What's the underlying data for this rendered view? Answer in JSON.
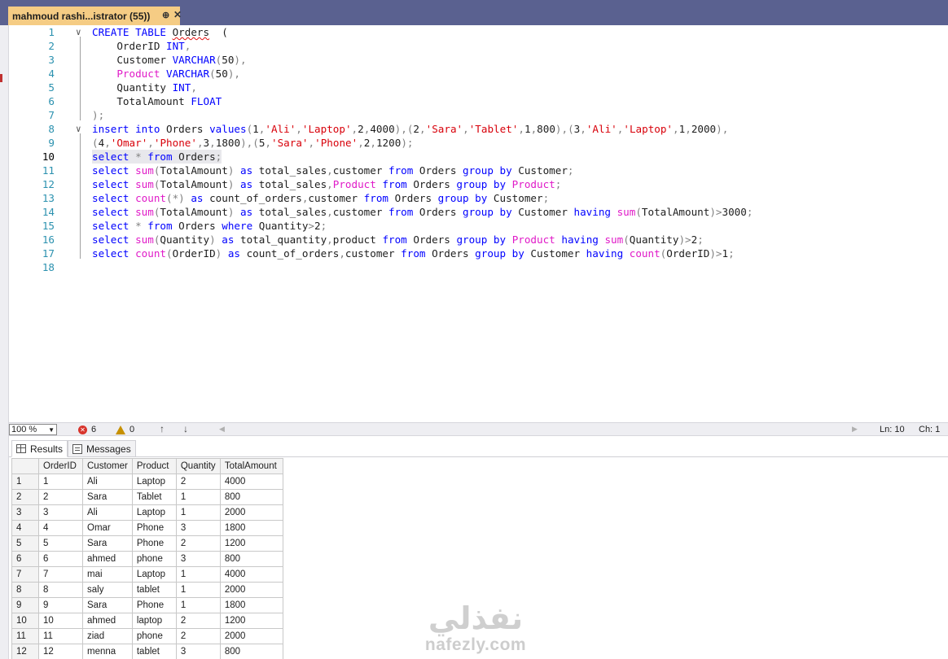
{
  "tab": {
    "title": "mahmoud rashi...istrator (55))",
    "pin": "⊕",
    "close": "✕"
  },
  "colors": {
    "keyword": "#0000ff",
    "string": "#d8000a",
    "function": "#e01ac8",
    "operator": "#808080",
    "line_number": "#2b91af",
    "tab_bg": "#f5cc84",
    "tabstrip_bg": "#5a6190"
  },
  "editor": {
    "current_line": 10,
    "lines": [
      {
        "n": "1"
      },
      {
        "n": "2"
      },
      {
        "n": "3"
      },
      {
        "n": "4"
      },
      {
        "n": "5"
      },
      {
        "n": "6"
      },
      {
        "n": "7"
      },
      {
        "n": "8"
      },
      {
        "n": "9"
      },
      {
        "n": "10"
      },
      {
        "n": "11"
      },
      {
        "n": "12"
      },
      {
        "n": "13"
      },
      {
        "n": "14"
      },
      {
        "n": "15"
      },
      {
        "n": "16"
      },
      {
        "n": "17"
      },
      {
        "n": "18"
      }
    ],
    "code": [
      [
        [
          "kw",
          "CREATE TABLE "
        ],
        [
          "sq",
          "Orders"
        ],
        [
          "",
          "  ("
        ]
      ],
      [
        [
          "",
          "    OrderID "
        ],
        [
          "kw",
          "INT"
        ],
        [
          "gr",
          ","
        ]
      ],
      [
        [
          "",
          "    Customer "
        ],
        [
          "kw",
          "VARCHAR"
        ],
        [
          "gr",
          "("
        ],
        [
          "",
          "50"
        ],
        [
          "gr",
          "),"
        ]
      ],
      [
        [
          "fn",
          "    Product "
        ],
        [
          "kw",
          "VARCHAR"
        ],
        [
          "gr",
          "("
        ],
        [
          "",
          "50"
        ],
        [
          "gr",
          "),"
        ]
      ],
      [
        [
          "",
          "    Quantity "
        ],
        [
          "kw",
          "INT"
        ],
        [
          "gr",
          ","
        ]
      ],
      [
        [
          "",
          "    TotalAmount "
        ],
        [
          "kw",
          "FLOAT"
        ]
      ],
      [
        [
          "gr",
          ");"
        ]
      ],
      [
        [
          "kw",
          "insert into "
        ],
        [
          "",
          "Orders "
        ],
        [
          "kw",
          "values"
        ],
        [
          "gr",
          "("
        ],
        [
          "",
          "1"
        ],
        [
          "gr",
          ","
        ],
        [
          "str",
          "'Ali'"
        ],
        [
          "gr",
          ","
        ],
        [
          "str",
          "'Laptop'"
        ],
        [
          "gr",
          ","
        ],
        [
          "",
          "2"
        ],
        [
          "gr",
          ","
        ],
        [
          "",
          "4000"
        ],
        [
          "gr",
          "),("
        ],
        [
          "",
          "2"
        ],
        [
          "gr",
          ","
        ],
        [
          "str",
          "'Sara'"
        ],
        [
          "gr",
          ","
        ],
        [
          "str",
          "'Tablet'"
        ],
        [
          "gr",
          ","
        ],
        [
          "",
          "1"
        ],
        [
          "gr",
          ","
        ],
        [
          "",
          "800"
        ],
        [
          "gr",
          "),("
        ],
        [
          "",
          "3"
        ],
        [
          "gr",
          ","
        ],
        [
          "str",
          "'Ali'"
        ],
        [
          "gr",
          ","
        ],
        [
          "str",
          "'Laptop'"
        ],
        [
          "gr",
          ","
        ],
        [
          "",
          "1"
        ],
        [
          "gr",
          ","
        ],
        [
          "",
          "2000"
        ],
        [
          "gr",
          "),"
        ]
      ],
      [
        [
          "gr",
          "("
        ],
        [
          "",
          "4"
        ],
        [
          "gr",
          ","
        ],
        [
          "str",
          "'Omar'"
        ],
        [
          "gr",
          ","
        ],
        [
          "str",
          "'Phone'"
        ],
        [
          "gr",
          ","
        ],
        [
          "",
          "3"
        ],
        [
          "gr",
          ","
        ],
        [
          "",
          "1800"
        ],
        [
          "gr",
          "),("
        ],
        [
          "",
          "5"
        ],
        [
          "gr",
          ","
        ],
        [
          "str",
          "'Sara'"
        ],
        [
          "gr",
          ","
        ],
        [
          "str",
          "'Phone'"
        ],
        [
          "gr",
          ","
        ],
        [
          "",
          "2"
        ],
        [
          "gr",
          ","
        ],
        [
          "",
          "1200"
        ],
        [
          "gr",
          ");"
        ]
      ],
      [
        [
          "kw",
          "select "
        ],
        [
          "gr",
          "* "
        ],
        [
          "kw",
          "from "
        ],
        [
          "",
          "Orders"
        ],
        [
          "gr",
          ";"
        ]
      ],
      [
        [
          "kw",
          "select "
        ],
        [
          "fn",
          "sum"
        ],
        [
          "gr",
          "("
        ],
        [
          "",
          "TotalAmount"
        ],
        [
          "gr",
          ") "
        ],
        [
          "kw",
          "as "
        ],
        [
          "",
          "total_sales"
        ],
        [
          "gr",
          ","
        ],
        [
          "",
          "customer "
        ],
        [
          "kw",
          "from "
        ],
        [
          "",
          "Orders "
        ],
        [
          "kw",
          "group by "
        ],
        [
          "",
          "Customer"
        ],
        [
          "gr",
          ";"
        ]
      ],
      [
        [
          "kw",
          "select "
        ],
        [
          "fn",
          "sum"
        ],
        [
          "gr",
          "("
        ],
        [
          "",
          "TotalAmount"
        ],
        [
          "gr",
          ") "
        ],
        [
          "kw",
          "as "
        ],
        [
          "",
          "total_sales"
        ],
        [
          "gr",
          ","
        ],
        [
          "fn",
          "Product "
        ],
        [
          "kw",
          "from "
        ],
        [
          "",
          "Orders "
        ],
        [
          "kw",
          "group by "
        ],
        [
          "fn",
          "Product"
        ],
        [
          "gr",
          ";"
        ]
      ],
      [
        [
          "kw",
          "select "
        ],
        [
          "fn",
          "count"
        ],
        [
          "gr",
          "(*) "
        ],
        [
          "kw",
          "as "
        ],
        [
          "",
          "count_of_orders"
        ],
        [
          "gr",
          ","
        ],
        [
          "",
          "customer "
        ],
        [
          "kw",
          "from "
        ],
        [
          "",
          "Orders "
        ],
        [
          "kw",
          "group by "
        ],
        [
          "",
          "Customer"
        ],
        [
          "gr",
          ";"
        ]
      ],
      [
        [
          "kw",
          "select "
        ],
        [
          "fn",
          "sum"
        ],
        [
          "gr",
          "("
        ],
        [
          "",
          "TotalAmount"
        ],
        [
          "gr",
          ") "
        ],
        [
          "kw",
          "as "
        ],
        [
          "",
          "total_sales"
        ],
        [
          "gr",
          ","
        ],
        [
          "",
          "customer "
        ],
        [
          "kw",
          "from "
        ],
        [
          "",
          "Orders "
        ],
        [
          "kw",
          "group by "
        ],
        [
          "",
          "Customer "
        ],
        [
          "kw",
          "having "
        ],
        [
          "fn",
          "sum"
        ],
        [
          "gr",
          "("
        ],
        [
          "",
          "TotalAmount"
        ],
        [
          "gr",
          ")>"
        ],
        [
          "",
          "3000"
        ],
        [
          "gr",
          ";"
        ]
      ],
      [
        [
          "kw",
          "select "
        ],
        [
          "gr",
          "* "
        ],
        [
          "kw",
          "from "
        ],
        [
          "",
          "Orders "
        ],
        [
          "kw",
          "where "
        ],
        [
          "",
          "Quantity"
        ],
        [
          "gr",
          ">"
        ],
        [
          "",
          "2"
        ],
        [
          "gr",
          ";"
        ]
      ],
      [
        [
          "kw",
          "select "
        ],
        [
          "fn",
          "sum"
        ],
        [
          "gr",
          "("
        ],
        [
          "",
          "Quantity"
        ],
        [
          "gr",
          ") "
        ],
        [
          "kw",
          "as "
        ],
        [
          "",
          "total_quantity"
        ],
        [
          "gr",
          ","
        ],
        [
          "",
          "product "
        ],
        [
          "kw",
          "from "
        ],
        [
          "",
          "Orders "
        ],
        [
          "kw",
          "group by "
        ],
        [
          "fn",
          "Product "
        ],
        [
          "kw",
          "having "
        ],
        [
          "fn",
          "sum"
        ],
        [
          "gr",
          "("
        ],
        [
          "",
          "Quantity"
        ],
        [
          "gr",
          ")>"
        ],
        [
          "",
          "2"
        ],
        [
          "gr",
          ";"
        ]
      ],
      [
        [
          "kw",
          "select "
        ],
        [
          "fn",
          "count"
        ],
        [
          "gr",
          "("
        ],
        [
          "",
          "OrderID"
        ],
        [
          "gr",
          ") "
        ],
        [
          "kw",
          "as "
        ],
        [
          "",
          "count_of_orders"
        ],
        [
          "gr",
          ","
        ],
        [
          "",
          "customer "
        ],
        [
          "kw",
          "from "
        ],
        [
          "",
          "Orders "
        ],
        [
          "kw",
          "group by "
        ],
        [
          "",
          "Customer "
        ],
        [
          "kw",
          "having "
        ],
        [
          "fn",
          "count"
        ],
        [
          "gr",
          "("
        ],
        [
          "",
          "OrderID"
        ],
        [
          "gr",
          ")>"
        ],
        [
          "",
          "1"
        ],
        [
          "gr",
          ";"
        ]
      ],
      []
    ]
  },
  "statusbar": {
    "zoom": "100 %",
    "errors": "6",
    "warnings": "0",
    "up_icon": "↑",
    "down_icon": "↓",
    "position_ln": "Ln: 10",
    "position_ch": "Ch: 1"
  },
  "results": {
    "tabs": [
      {
        "label": "Results",
        "icon": "grid-icon"
      },
      {
        "label": "Messages",
        "icon": "messages-icon"
      }
    ],
    "columns": [
      "OrderID",
      "Customer",
      "Product",
      "Quantity",
      "TotalAmount"
    ],
    "rows": [
      [
        "1",
        "1",
        "Ali",
        "Laptop",
        "2",
        "4000"
      ],
      [
        "2",
        "2",
        "Sara",
        "Tablet",
        "1",
        "800"
      ],
      [
        "3",
        "3",
        "Ali",
        "Laptop",
        "1",
        "2000"
      ],
      [
        "4",
        "4",
        "Omar",
        "Phone",
        "3",
        "1800"
      ],
      [
        "5",
        "5",
        "Sara",
        "Phone",
        "2",
        "1200"
      ],
      [
        "6",
        "6",
        "ahmed",
        "phone",
        "3",
        "800"
      ],
      [
        "7",
        "7",
        "mai",
        "Laptop",
        "1",
        "4000"
      ],
      [
        "8",
        "8",
        "saly",
        "tablet",
        "1",
        "2000"
      ],
      [
        "9",
        "9",
        "Sara",
        "Phone",
        "1",
        "1800"
      ],
      [
        "10",
        "10",
        "ahmed",
        "laptop",
        "2",
        "1200"
      ],
      [
        "11",
        "11",
        "ziad",
        "phone",
        "2",
        "2000"
      ],
      [
        "12",
        "12",
        "menna",
        "tablet",
        "3",
        "800"
      ]
    ]
  },
  "watermark": {
    "arabic": "نفذلي",
    "latin": "nafezly.com"
  }
}
